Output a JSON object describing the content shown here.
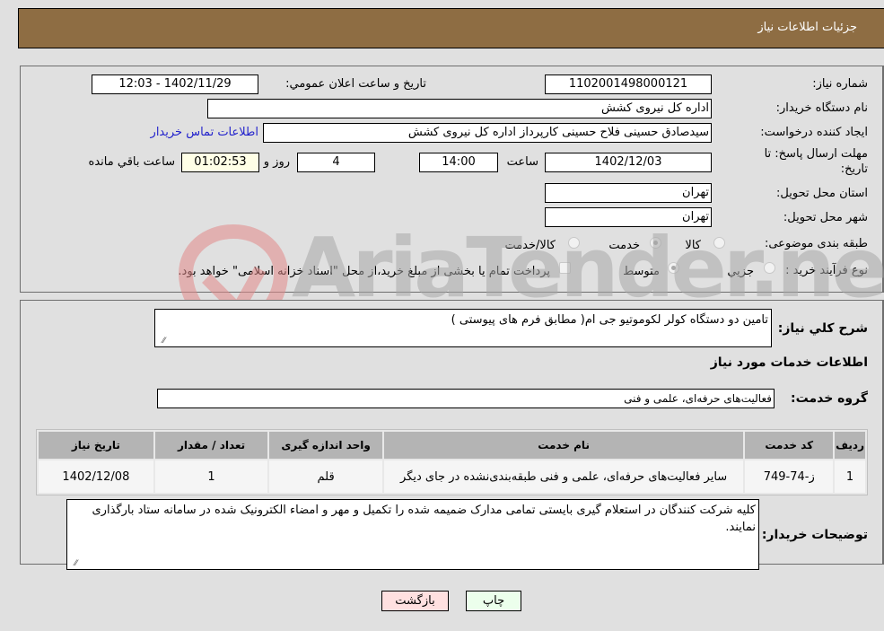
{
  "header": {
    "title": "جزئیات اطلاعات نیاز"
  },
  "details": {
    "need_number_label": "شماره نیاز:",
    "need_number": "1102001498000121",
    "announce_label": "تاریخ و ساعت اعلان عمومي:",
    "announce_value": "1402/11/29 - 12:03",
    "buyer_org_label": "نام دستگاه خریدار:",
    "buyer_org": "اداره کل نیروی کشش",
    "creator_label": "ایجاد کننده درخواست:",
    "creator": "سیدصادق حسینی فلاح حسینی کارپرداز اداره کل نیروی کشش",
    "contact_link": "اطلاعات تماس خریدار",
    "deadline_label_line1": "مهلت ارسال پاسخ: تا",
    "deadline_label_line2": "تاریخ:",
    "deadline_date": "1402/12/03",
    "time_label": "ساعت",
    "deadline_time": "14:00",
    "days_value": "4",
    "days_label": "روز و",
    "remaining_time": "01:02:53",
    "remaining_label": "ساعت باقي مانده",
    "province_label": "استان محل تحویل:",
    "province": "تهران",
    "city_label": "شهر محل تحویل:",
    "city": "تهران",
    "category_label": "طبقه بندی موضوعی:",
    "category_options": [
      {
        "label": "کالا",
        "checked": false
      },
      {
        "label": "خدمت",
        "checked": true
      },
      {
        "label": "کالا/خدمت",
        "checked": false
      }
    ],
    "process_label": "نوع فرآیند خرید :",
    "process_options": [
      {
        "label": "جزيي",
        "checked": false
      },
      {
        "label": "متوسط",
        "checked": true
      }
    ],
    "treasury_note": "پرداخت تمام یا بخشی از مبلغ خرید،از محل \"اسناد خزانه اسلامی\" خواهد بود."
  },
  "description": {
    "label": "شرح کلي نیاز:",
    "value": "تامین دو دستگاه کولر لکوموتیو جی ام( مطابق فرم های پیوستی )"
  },
  "services": {
    "section_title": "اطلاعات خدمات مورد نیاز",
    "group_label": "گروه خدمت:",
    "group_value": "فعالیت‌های حرفه‌ای، علمی و فنی",
    "columns": [
      "ردیف",
      "کد خدمت",
      "نام خدمت",
      "واحد اندازه گیری",
      "تعداد / مقدار",
      "تاریخ نیاز"
    ],
    "rows": [
      {
        "index": "1",
        "code": "ز-74-749",
        "name": "سایر فعالیت‌های حرفه‌ای، علمی و فنی طبقه‌بندی‌نشده در جای دیگر",
        "unit": "قلم",
        "quantity": "1",
        "date": "1402/12/08"
      }
    ]
  },
  "buyer_notes": {
    "label": "توضیحات خریدار:",
    "value": "کلیه شرکت کنندگان در استعلام گیری بایستی تمامی مدارک ضمیمه شده را تکمیل و مهر و امضاء الکترونیک شده در سامانه ستاد بارگذاری نمایند."
  },
  "buttons": {
    "print": "چاپ",
    "back": "بازگشت"
  },
  "watermark": {
    "text": "AriaTender.neT"
  },
  "colors": {
    "header_bg": "#8e6d43",
    "link": "#2222cc",
    "back_btn": "#ffe0e0",
    "print_btn": "#ecffec"
  }
}
